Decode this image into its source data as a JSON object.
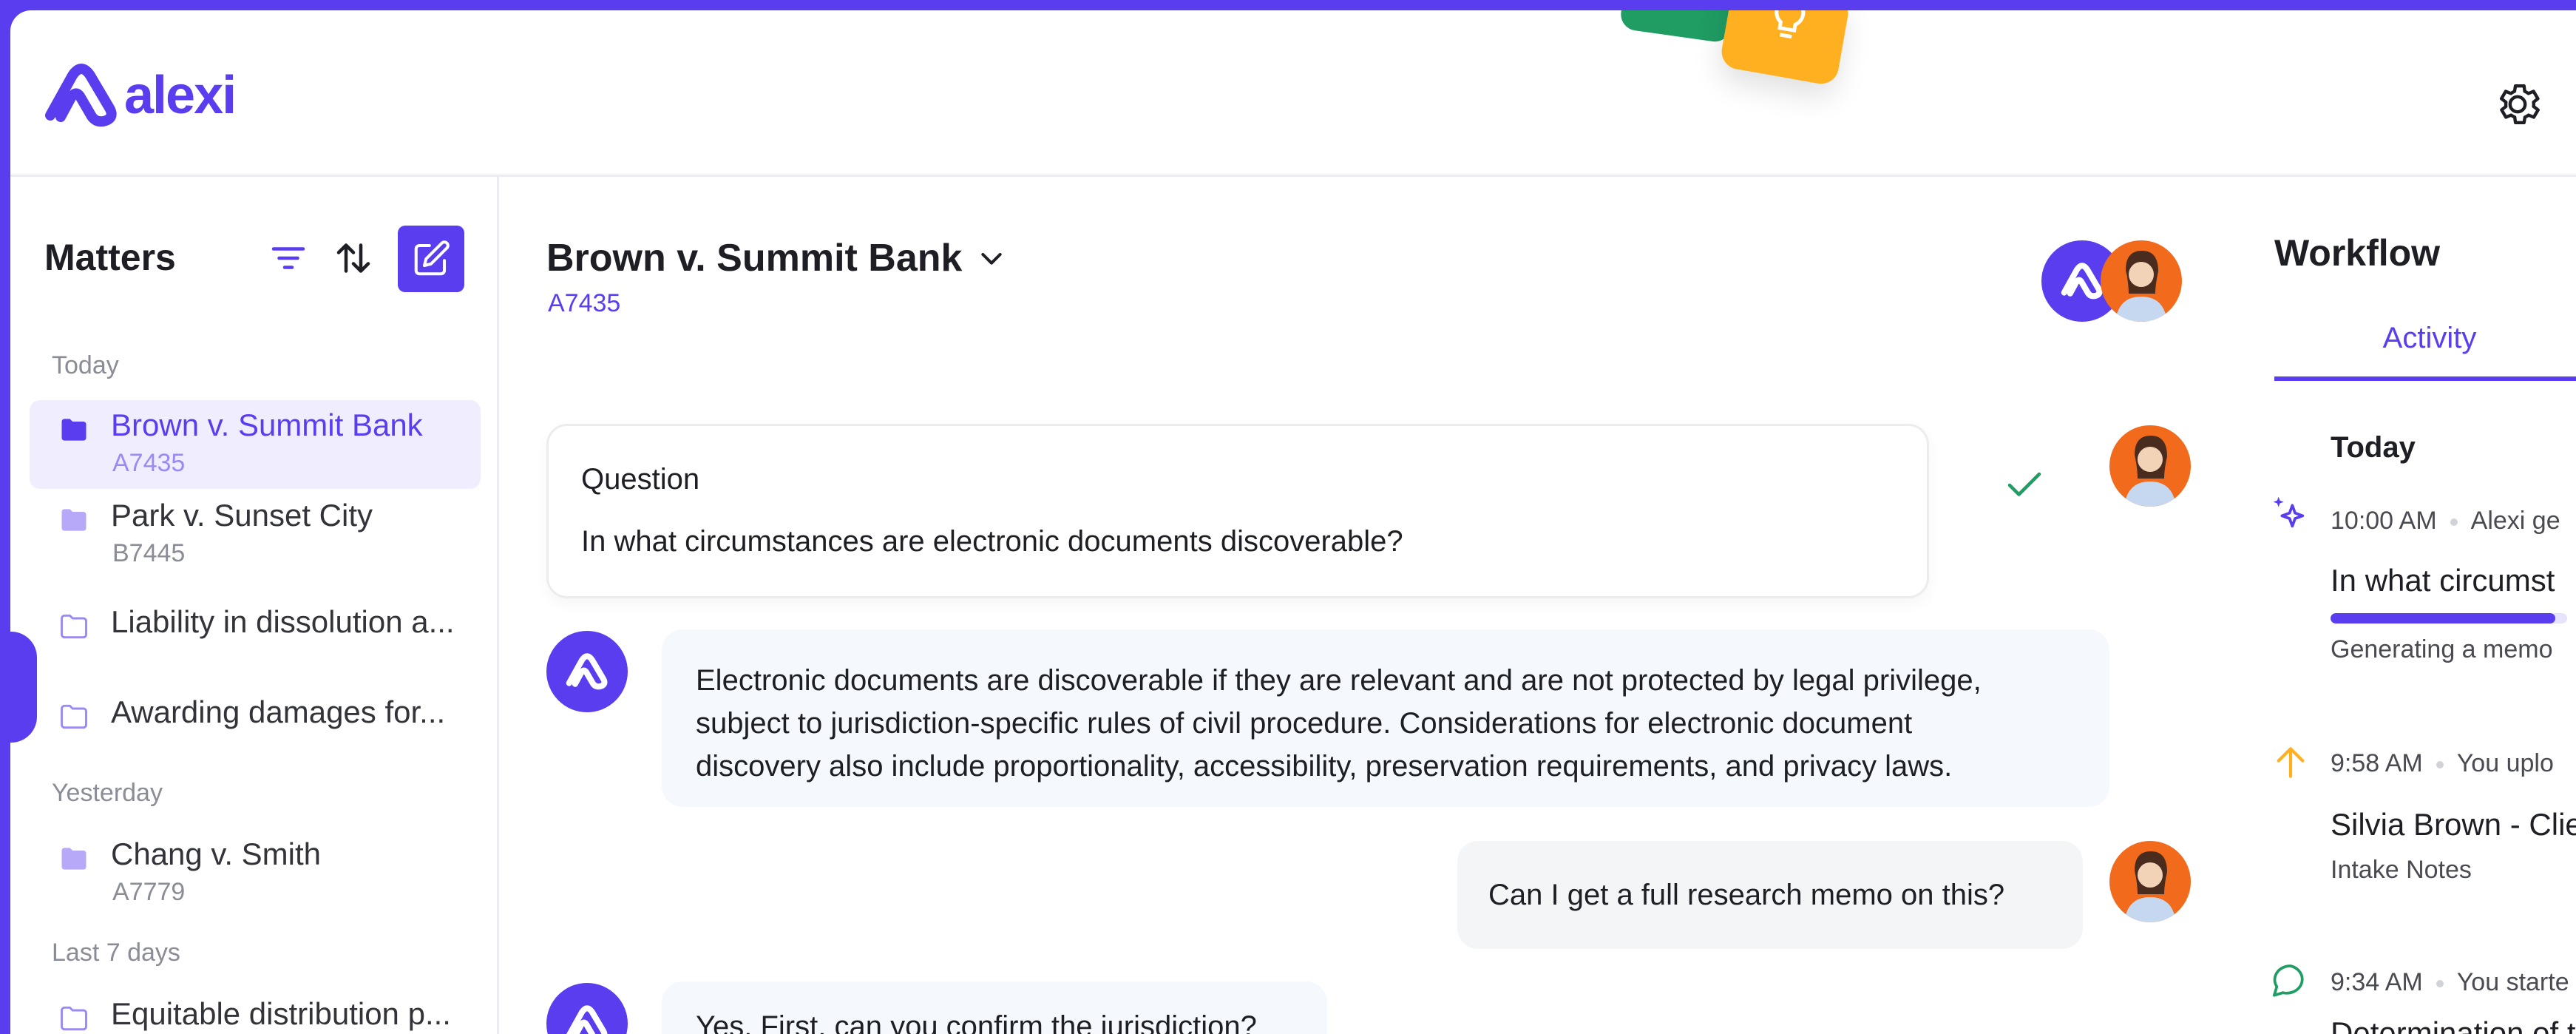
{
  "brand": {
    "name": "alexi",
    "accent": "#5b3df0"
  },
  "sidebar": {
    "title": "Matters",
    "groups": [
      {
        "label": "Today"
      },
      {
        "label": "Yesterday"
      },
      {
        "label": "Last 7 days"
      }
    ],
    "items": [
      {
        "name": "Brown v. Summit Bank",
        "code": "A7435",
        "active": true,
        "icon": "folder-filled-icon"
      },
      {
        "name": "Park v. Sunset City",
        "code": "B7445",
        "icon": "folder-filled-icon"
      },
      {
        "name": "Liability in dissolution a...",
        "code": "",
        "icon": "folder-outline-icon"
      },
      {
        "name": "Awarding damages for...",
        "code": "",
        "icon": "folder-outline-icon"
      },
      {
        "name": "Chang v. Smith",
        "code": "A7779",
        "icon": "folder-filled-icon"
      },
      {
        "name": "Equitable distribution p...",
        "code": "",
        "icon": "folder-outline-icon"
      }
    ]
  },
  "main": {
    "case_title": "Brown v. Summit Bank",
    "case_code": "A7435",
    "question": {
      "label": "Question",
      "text": "In what circumstances are electronic documents discoverable?",
      "status": "answered"
    },
    "messages": [
      {
        "from": "alexi",
        "lines": [
          "Electronic documents are discoverable if they are relevant and are not protected by legal privilege,",
          "subject to jurisdiction-specific rules of civil procedure. Considerations for electronic document",
          "discovery also include proportionality, accessibility, preservation requirements, and privacy laws."
        ]
      },
      {
        "from": "user",
        "lines": [
          "Can I get a full research memo on this?"
        ]
      },
      {
        "from": "alexi",
        "lines": [
          "Yes. First, can you confirm the jurisdiction?"
        ]
      }
    ]
  },
  "workflow": {
    "title": "Workflow",
    "tab": "Activity",
    "day": "Today",
    "events": [
      {
        "time": "10:00 AM",
        "actor": "Alexi ge",
        "title": "In what circumst",
        "sub": "Generating a memo",
        "icon": "sparkle-icon",
        "progress": 0.95
      },
      {
        "time": "9:58 AM",
        "actor": "You uplo",
        "title": "Silvia Brown - Clie",
        "sub": "Intake Notes",
        "icon": "upload-arrow-icon"
      },
      {
        "time": "9:34 AM",
        "actor": "You starte",
        "title": "Determination of t",
        "sub": "",
        "icon": "chat-bubble-icon"
      }
    ]
  }
}
